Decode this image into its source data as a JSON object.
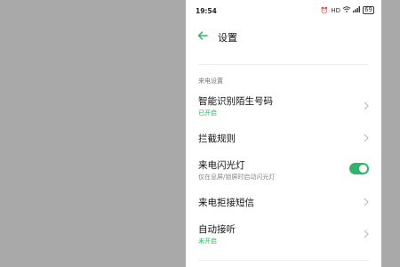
{
  "status": {
    "time": "19:54",
    "icons": [
      "alarm-icon",
      "hd-icon",
      "wifi-icon",
      "signal-icon",
      "battery-icon"
    ],
    "hd_text": "HD",
    "battery": "69"
  },
  "header": {
    "title": "设置"
  },
  "section": {
    "label": "来电设置"
  },
  "rows": [
    {
      "title": "智能识别陌生号码",
      "subtitle": "已开启"
    },
    {
      "title": "拦截规则"
    },
    {
      "title": "来电闪光灯",
      "subtitle": "仅在息屏/锁屏时启动闪光灯",
      "toggle_on": true
    },
    {
      "title": "来电拒接短信"
    },
    {
      "title": "自动接听",
      "subtitle": "未开启"
    }
  ],
  "colors": {
    "accent": "#2fb56a",
    "backdrop": "#a9a9a9"
  }
}
